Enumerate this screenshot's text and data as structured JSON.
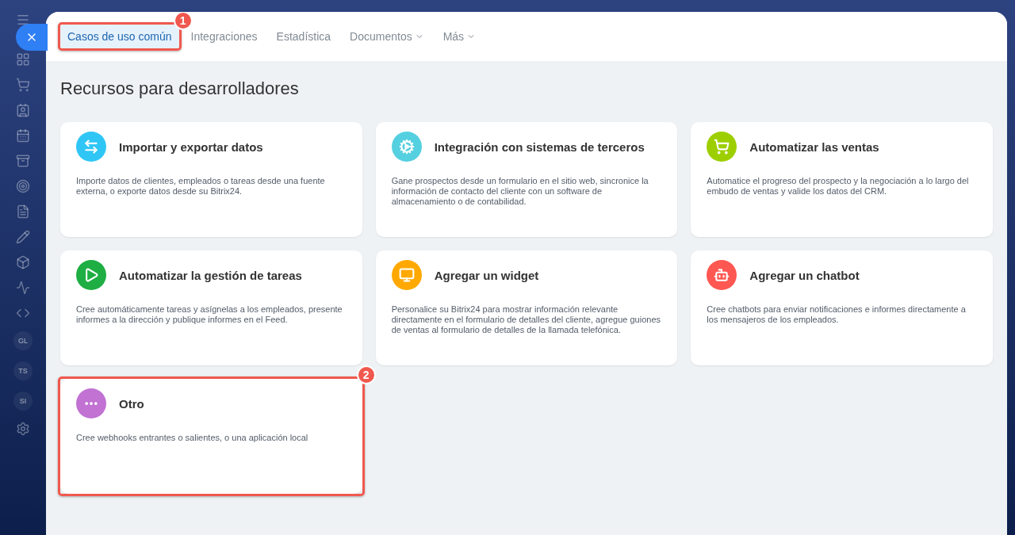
{
  "sidebar": {
    "items": [
      {
        "label": "GL"
      },
      {
        "label": "TS"
      },
      {
        "label": "SI"
      }
    ]
  },
  "tabs": [
    {
      "label": "Casos de uso común",
      "selected": true,
      "dropdown": false,
      "callout": "1"
    },
    {
      "label": "Integraciones",
      "selected": false,
      "dropdown": false
    },
    {
      "label": "Estadística",
      "selected": false,
      "dropdown": false
    },
    {
      "label": "Documentos",
      "selected": false,
      "dropdown": true
    },
    {
      "label": "Más",
      "selected": false,
      "dropdown": true
    }
  ],
  "heading": "Recursos para desarrolladores",
  "cards": [
    {
      "title": "Importar y exportar datos",
      "description": "Importe datos de clientes, empleados o tareas desde una fuente externa, o exporte datos desde su Bitrix24.",
      "color": "#2fc6f6"
    },
    {
      "title": "Integración con sistemas de terceros",
      "description": "Gane prospectos desde un formulario en el sitio web, sincronice la información de contacto del cliente con un software de almacenamiento o de contabilidad.",
      "color": "#55d0e0"
    },
    {
      "title": "Automatizar las ventas",
      "description": "Automatice el progreso del prospecto y la negociación a lo largo del embudo de ventas y valide los datos del CRM.",
      "color": "#9dcf00"
    },
    {
      "title": "Automatizar la gestión de tareas",
      "description": "Cree automáticamente tareas y asígnelas a los empleados, presente informes a la dirección y publique informes en el Feed.",
      "color": "#1eae43"
    },
    {
      "title": "Agregar un widget",
      "description": "Personalice su Bitrix24 para mostrar información relevante directamente en el formulario de detalles del cliente, agregue guiones de ventas al formulario de detalles de la llamada telefónica.",
      "color": "#ffa900"
    },
    {
      "title": "Agregar un chatbot",
      "description": "Cree chatbots para enviar notificaciones e informes directamente a los mensajeros de los empleados.",
      "color": "#ff5752"
    },
    {
      "title": "Otro",
      "description": "Cree webhooks entrantes o salientes, o una aplicación local",
      "color": "#c172d3",
      "callout": "2"
    }
  ]
}
